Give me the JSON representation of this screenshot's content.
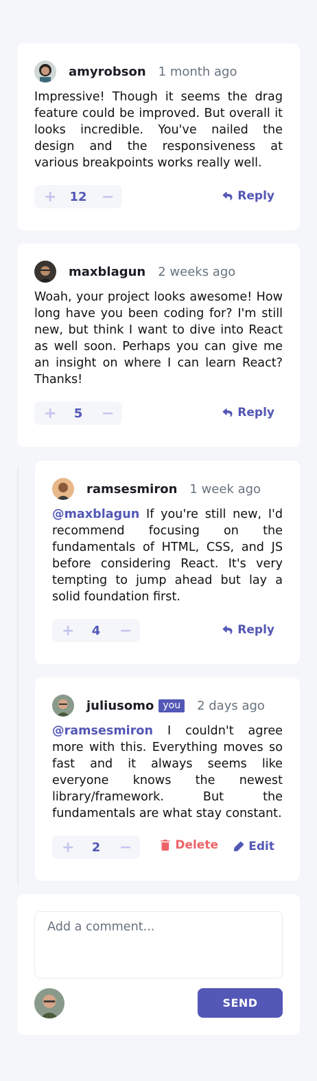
{
  "comments": [
    {
      "username": "amyrobson",
      "when": "1 month ago",
      "text": "Impressive! Though it seems the drag feature could be improved. But overall it looks incredible. You've nailed the design and the responsiveness at various breakpoints works really well.",
      "score": "12",
      "reply_label": "Reply"
    },
    {
      "username": "maxblagun",
      "when": "2 weeks ago",
      "text": "Woah, your project looks awesome! How long have you been coding for? I'm still new, but think I want to dive into React as well soon. Perhaps you can give me an insight on where I can learn React? Thanks!",
      "score": "5",
      "reply_label": "Reply"
    }
  ],
  "replies": [
    {
      "username": "ramsesmiron",
      "when": "1 week ago",
      "mention": "@maxblagun",
      "text": "If you're still new, I'd recommend focusing on the fundamentals of HTML, CSS, and JS before considering React. It's very tempting to jump ahead but lay a solid foundation first.",
      "score": "4",
      "reply_label": "Reply"
    },
    {
      "username": "juliusomo",
      "badge": "you",
      "when": "2 days ago",
      "mention": "@ramsesmiron",
      "text": "I couldn't agree more with this. Everything moves so fast and it always seems like everyone knows the newest library/framework. But the fundamentals are what stay constant.",
      "score": "2",
      "delete_label": "Delete",
      "edit_label": "Edit"
    }
  ],
  "vote_icons": {
    "plus": "+",
    "minus": "−"
  },
  "composer": {
    "placeholder": "Add a comment...",
    "send_label": "SEND"
  },
  "colors": {
    "accent": "#5357b6",
    "danger": "#ed6368",
    "background": "#f5f6fa",
    "muted_text": "#67727e"
  }
}
